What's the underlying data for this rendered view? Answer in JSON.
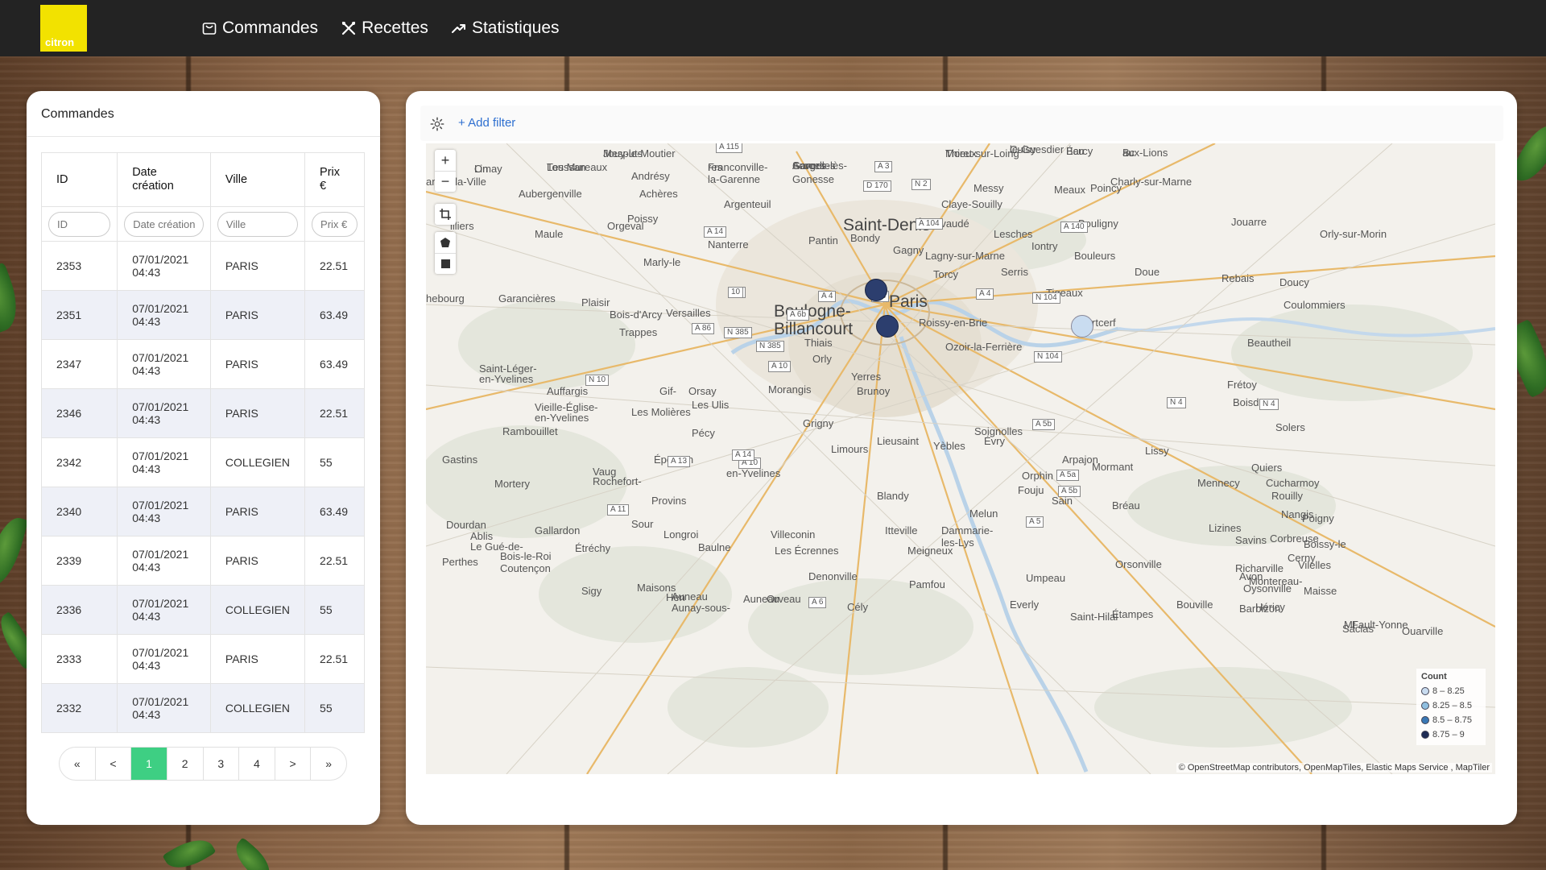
{
  "app": {
    "logo_text": "citron"
  },
  "nav": {
    "items": [
      {
        "label": "Commandes",
        "icon": "shopping-bag-icon"
      },
      {
        "label": "Recettes",
        "icon": "utensils-icon"
      },
      {
        "label": "Statistiques",
        "icon": "trending-up-icon"
      }
    ]
  },
  "orders": {
    "title": "Commandes",
    "columns": [
      "ID",
      "Date création",
      "Ville",
      "Prix €"
    ],
    "filters": [
      "ID",
      "Date création",
      "Ville",
      "Prix €"
    ],
    "rows": [
      {
        "id": "2353",
        "date": "07/01/2021",
        "time": "04:43",
        "ville": "PARIS",
        "prix": "22.51"
      },
      {
        "id": "2351",
        "date": "07/01/2021",
        "time": "04:43",
        "ville": "PARIS",
        "prix": "63.49"
      },
      {
        "id": "2347",
        "date": "07/01/2021",
        "time": "04:43",
        "ville": "PARIS",
        "prix": "63.49"
      },
      {
        "id": "2346",
        "date": "07/01/2021",
        "time": "04:43",
        "ville": "PARIS",
        "prix": "22.51"
      },
      {
        "id": "2342",
        "date": "07/01/2021",
        "time": "04:43",
        "ville": "COLLEGIEN",
        "prix": "55"
      },
      {
        "id": "2340",
        "date": "07/01/2021",
        "time": "04:43",
        "ville": "PARIS",
        "prix": "63.49"
      },
      {
        "id": "2339",
        "date": "07/01/2021",
        "time": "04:43",
        "ville": "PARIS",
        "prix": "22.51"
      },
      {
        "id": "2336",
        "date": "07/01/2021",
        "time": "04:43",
        "ville": "COLLEGIEN",
        "prix": "55"
      },
      {
        "id": "2333",
        "date": "07/01/2021",
        "time": "04:43",
        "ville": "PARIS",
        "prix": "22.51"
      },
      {
        "id": "2332",
        "date": "07/01/2021",
        "time": "04:43",
        "ville": "COLLEGIEN",
        "prix": "55"
      }
    ],
    "pagination": {
      "first": "«",
      "prev": "<",
      "pages": [
        "1",
        "2",
        "3",
        "4"
      ],
      "current": "1",
      "next": ">",
      "last": "»"
    }
  },
  "map": {
    "add_filter": "+ Add filter",
    "zoom_in": "+",
    "zoom_out": "−",
    "places_big": [
      "Saint-Denis",
      "Paris",
      "Boulogne-",
      "Billancourt"
    ],
    "places": [
      "Jouy-le-Moutier",
      "Sarcelles",
      "Thieux",
      "Cuisy",
      "Barcy",
      "aux-Lions",
      "Limay",
      "Les Mureaux",
      "Franconville-",
      "la-Garenne",
      "Garges-lès-",
      "Gonesse",
      "Messy",
      "Meaux",
      "Poincy",
      "Charly-sur-Marne",
      "antes-la-Ville",
      "Andrésy",
      "Aubergenville",
      "Achères",
      "Argenteuil",
      "Claye-Souilly",
      "Poissy",
      "Villevaudé",
      "Jouarre",
      "Bouligny",
      "illiers",
      "Orgeval",
      "Maule",
      "Nanterre",
      "Pantin",
      "Bondy",
      "Lesches",
      "Iontry",
      "Orly-sur-Morin",
      "Gagny",
      "Bouleurs",
      "Marly-le",
      "Lagny-sur-Marne",
      "Serris",
      "Doue",
      "Rebais",
      "Doucy",
      "Torcy",
      "Tigeaux",
      "hebourg",
      "Garancières",
      "Plaisir",
      "Bois-d'Arcy",
      "Versailles",
      "Coulommiers",
      "Roissy-en-Brie",
      "Mortcerf",
      "Trappes",
      "Thiais",
      "Ozoir-la-Ferrière",
      "Beautheil",
      "Orly",
      "Saint-Léger-",
      "en-Yvelines",
      "Auffargis",
      "Gif-",
      "Orsay",
      "Les Ulis",
      "Yerres",
      "Brunoy",
      "Morangis",
      "Frétoy",
      "Boisdon",
      "Cern",
      "Vieille-Église-",
      "en-Yvelines",
      "Les Molières",
      "Rambouillet",
      "Grigny",
      "Soignolles",
      "Lieusaint",
      "Solers",
      "Pécy",
      "Limours",
      "Évry",
      "Yèbles",
      "Lissy",
      "Gastins",
      "Épernon",
      "Vaug",
      "Rochefort-",
      "en-Yvelines",
      "Arpajon",
      "Mormant",
      "Quiers",
      "Mortery",
      "Orphin",
      "Fouju",
      "Blandy",
      "Mennecy",
      "Cucharmoy",
      "Rouilly",
      "Provins",
      "Sain",
      "Bréau",
      "Nangis",
      "Poigny",
      "Sour",
      "Dourdan",
      "Gallardon",
      "Ablis",
      "Le Gué-de-",
      "Longroi",
      "Villeconin",
      "Itteville",
      "Melun",
      "Dammarie-",
      "les-Lys",
      "Lizines",
      "Savins",
      "Corbreuse",
      "Étréchy",
      "Baulne",
      "Les Écrennes",
      "Meigneux",
      "Umpeau",
      "Orsonville",
      "Richarville",
      "Boissy-le",
      "Cerny",
      "Vilelles",
      "Perthes",
      "Bois-le-Roi",
      "Coutençon",
      "Sigy",
      "Hen",
      "Auneau",
      "Aunay-sous-",
      "Auneau",
      "Orveau",
      "Cély",
      "Pamfou",
      "Everly",
      "Saint-Hilai",
      "Étampes",
      "Bouville",
      "Barbizon",
      "Héricy",
      "Maisons",
      "Denonville",
      "Oysonville",
      "Maisse",
      "Avon",
      "Montereau-",
      "Fault-Yonne",
      "Mt",
      "Ouarville",
      "Saclas",
      "Mesputs",
      "Auvers",
      "Moret-sur-Loing",
      "le-Guesdier",
      "Écu",
      "Bc",
      "On",
      "Toussan",
      "res"
    ],
    "roads": [
      "A 115",
      "A 3",
      "D 170",
      "N 2",
      "A 14",
      "A 104",
      "A 140",
      "N 104",
      "A 4",
      "A 4",
      "A 4",
      "A 6b",
      "A 86",
      "N 385",
      "N 385",
      "A 10",
      "N 104",
      "N 4",
      "N 4",
      "N 10",
      "A 5b",
      "A 5a",
      "A 5b",
      "A 5",
      "A 11",
      "A 10",
      "A 6",
      "A 13",
      "A 14",
      "A 4",
      "10"
    ],
    "legend": {
      "title": "Count",
      "items": [
        {
          "label": "8 – 8.25",
          "color": "#c9dcf0"
        },
        {
          "label": "8.25 – 8.5",
          "color": "#8fbfe0"
        },
        {
          "label": "8.5 – 8.75",
          "color": "#3a78b5"
        },
        {
          "label": "8.75 – 9",
          "color": "#1e2c55"
        }
      ]
    },
    "markers": [
      {
        "place": "Paris nord",
        "count": 9,
        "color": "#2c3e6e"
      },
      {
        "place": "Paris sud",
        "count": 9,
        "color": "#2c3e6e"
      },
      {
        "place": "Collégien",
        "count": 8,
        "color": "#c9dcf0"
      }
    ],
    "attribution": "© OpenStreetMap contributors, OpenMapTiles, Elastic Maps Service , MapTiler"
  }
}
